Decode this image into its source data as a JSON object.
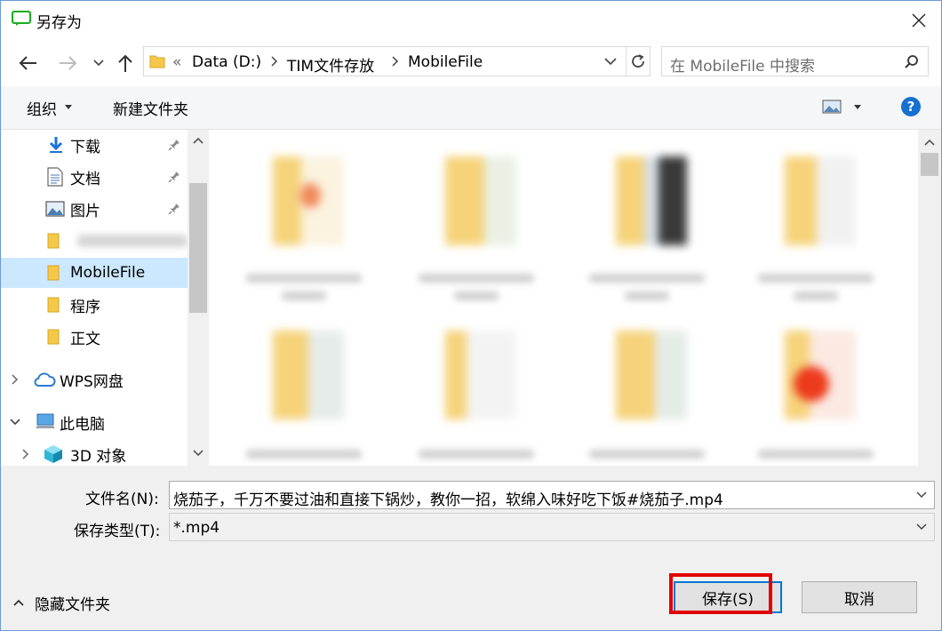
{
  "window": {
    "title": "另存为",
    "close_label": "×"
  },
  "address": {
    "overflow": "«",
    "crumbs": [
      "Data (D:)",
      "TIM文件存放",
      "MobileFile"
    ]
  },
  "search": {
    "placeholder": "在 MobileFile 中搜索"
  },
  "toolbar": {
    "organize": "组织",
    "new_folder": "新建文件夹"
  },
  "nav": {
    "items": [
      {
        "label": "下载",
        "icon": "download-arrow-icon",
        "pinned": true
      },
      {
        "label": "文档",
        "icon": "document-icon",
        "pinned": true
      },
      {
        "label": "图片",
        "icon": "picture-icon",
        "pinned": true
      },
      {
        "label": "",
        "icon": "folder-icon",
        "pinned": false
      },
      {
        "label": "MobileFile",
        "icon": "folder-icon",
        "selected": true
      },
      {
        "label": "程序",
        "icon": "folder-icon"
      },
      {
        "label": "正文",
        "icon": "folder-icon"
      },
      {
        "label": "WPS网盘",
        "icon": "cloud-icon",
        "expander": "collapsed"
      },
      {
        "label": "此电脑",
        "icon": "computer-icon",
        "expander": "expanded"
      },
      {
        "label": "3D 对象",
        "icon": "cube-3d-icon",
        "expander": "collapsed"
      }
    ]
  },
  "form": {
    "filename_label": "文件名(N):",
    "filename_value": "烧茄子，千万不要过油和直接下锅炒，教你一招，软绵入味好吃下饭#烧茄子.mp4",
    "filetype_label": "保存类型(T):",
    "filetype_value": "*.mp4",
    "hide_folders": "隐藏文件夹",
    "save": "保存(S)",
    "cancel": "取消"
  },
  "colors": {
    "accent": "#0078d7",
    "selection": "#cce8ff",
    "highlight": "#e00000",
    "folder": "#f5c84a"
  }
}
